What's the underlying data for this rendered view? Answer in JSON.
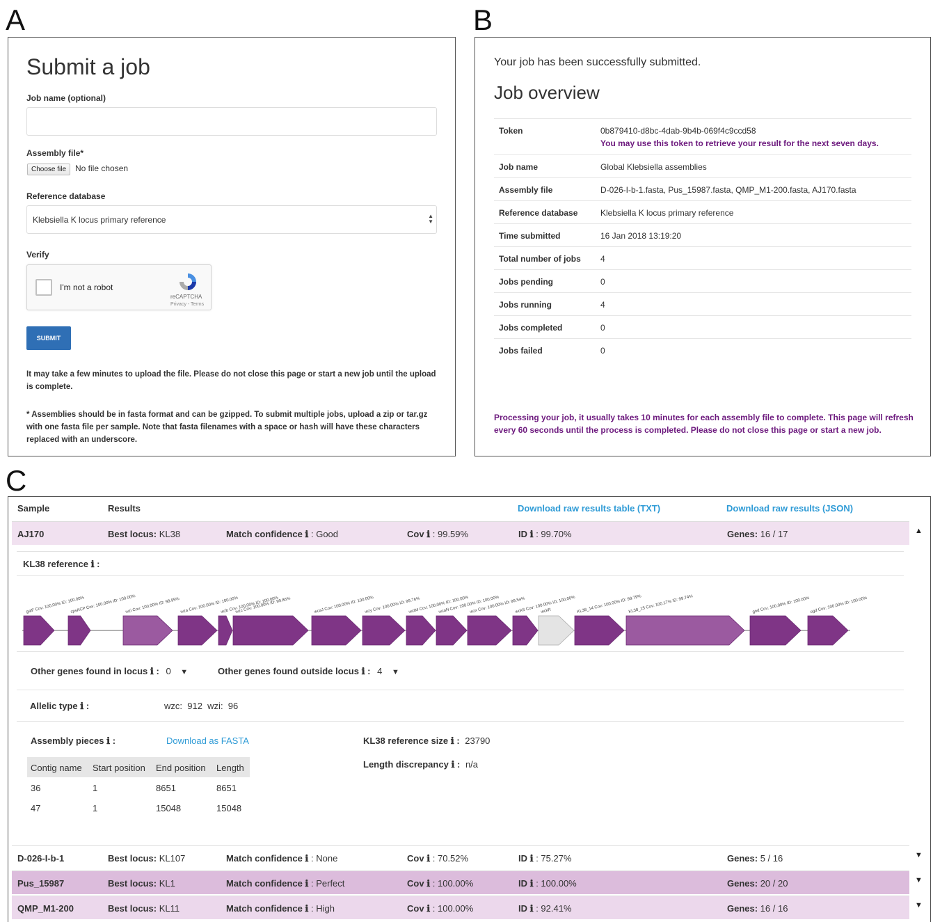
{
  "panels": {
    "a": "A",
    "b": "B",
    "c": "C"
  },
  "submit_form": {
    "title": "Submit a job",
    "job_name_label": "Job name (optional)",
    "job_name_value": "",
    "assembly_label": "Assembly file*",
    "choose_file": "Choose file",
    "no_file": "No file chosen",
    "ref_db_label": "Reference database",
    "ref_db_value": "Klebsiella K locus primary reference",
    "verify_label": "Verify",
    "captcha_text": "I'm not a robot",
    "captcha_brand": "reCAPTCHA",
    "captcha_links": "Privacy - Terms",
    "submit_label": "SUBMIT",
    "note1": "It may take a few minutes to upload the file. Please do not close this page or start a new job until the upload is complete.",
    "note2": "* Assemblies should be in fasta format and can be gzipped. To submit multiple jobs, upload a zip or tar.gz with one fasta file per sample. Note that fasta filenames with a space or hash will have these characters replaced with an underscore."
  },
  "job_overview": {
    "success": "Your job has been successfully submitted.",
    "title": "Job overview",
    "token_label": "Token",
    "token_value": "0b879410-d8bc-4dab-9b4b-069f4c9ccd58",
    "token_note": "You may use this token to retrieve your result for the next seven days.",
    "rows": [
      {
        "key": "Job name",
        "value": "Global Klebsiella assemblies"
      },
      {
        "key": "Assembly file",
        "value": "D-026-I-b-1.fasta, Pus_15987.fasta, QMP_M1-200.fasta, AJ170.fasta"
      },
      {
        "key": "Reference database",
        "value": "Klebsiella K locus primary reference"
      },
      {
        "key": "Time submitted",
        "value": "16 Jan 2018 13:19:20"
      },
      {
        "key": "Total number of jobs",
        "value": "4"
      },
      {
        "key": "Jobs pending",
        "value": "0"
      },
      {
        "key": "Jobs running",
        "value": "4"
      },
      {
        "key": "Jobs completed",
        "value": "0"
      },
      {
        "key": "Jobs failed",
        "value": "0"
      }
    ],
    "processing_note": "Processing your job, it usually takes 10 minutes for each assembly file to complete. This page will refresh every 60 seconds until the process is completed. Please do not close this page or start a new job."
  },
  "results": {
    "header": {
      "sample": "Sample",
      "results": "Results",
      "download_txt": "Download raw results table (TXT)",
      "download_json": "Download raw results (JSON)"
    },
    "labels": {
      "best_locus": "Best locus:",
      "match_conf": "Match confidence",
      "cov": "Cov",
      "id": "ID",
      "genes": "Genes:"
    },
    "expanded": {
      "sample": "AJ170",
      "locus": "KL38",
      "confidence": "Good",
      "cov": "99.59%",
      "id": "99.70%",
      "genes": "16 / 17",
      "reference_title": "KL38 reference",
      "other_in_label": "Other genes found in locus",
      "other_in_value": "0",
      "other_out_label": "Other genes found outside locus",
      "other_out_value": "4",
      "allelic_label": "Allelic type",
      "allelic_wzc_label": "wzc:",
      "allelic_wzc_value": "912",
      "allelic_wzi_label": "wzi:",
      "allelic_wzi_value": "96",
      "pieces_label": "Assembly pieces",
      "download_fasta": "Download as FASTA",
      "ref_size_label": "KL38 reference size",
      "ref_size_value": "23790",
      "length_disc_label": "Length discrepancy",
      "length_disc_value": "n/a",
      "table_headers": [
        "Contig name",
        "Start position",
        "End position",
        "Length"
      ],
      "table_rows": [
        [
          "36",
          "1",
          "8651",
          "8651"
        ],
        [
          "47",
          "1",
          "15048",
          "15048"
        ]
      ]
    },
    "genes": [
      {
        "label": "galF Cov: 100.00% ID: 100.00%",
        "color": "#7f3586"
      },
      {
        "label": "cpsACP Cov: 100.00% ID: 100.00%",
        "color": "#7f3586"
      },
      {
        "label": "wzi Cov: 100.00% ID: 98.95%",
        "color": "#9b5aa0"
      },
      {
        "label": "wza Cov: 100.00% ID: 100.00%",
        "color": "#7f3586"
      },
      {
        "label": "wzb Cov: 100.00% ID: 100.00%",
        "color": "#7f3586"
      },
      {
        "label": "wzc Cov: 100.00% ID: 99.86%",
        "color": "#7f3586"
      },
      {
        "label": "wcaJ Cov: 100.00% ID: 100.00%",
        "color": "#7f3586"
      },
      {
        "label": "wzy Cov: 100.00% ID: 99.76%",
        "color": "#7f3586"
      },
      {
        "label": "wctM Cov: 100.00% ID: 100.00%",
        "color": "#7f3586"
      },
      {
        "label": "wcaN Cov: 100.00% ID: 100.00%",
        "color": "#7f3586"
      },
      {
        "label": "wzx Cov: 100.00% ID: 99.54%",
        "color": "#7f3586"
      },
      {
        "label": "wckS Cov: 100.00% ID: 100.00%",
        "color": "#7f3586"
      },
      {
        "label": "wckR",
        "color": "#e4e4e4"
      },
      {
        "label": "KL38_14 Cov: 100.00% ID: 99.79%",
        "color": "#7f3586"
      },
      {
        "label": "KL38_15 Cov: 100.17% ID: 99.74%",
        "color": "#9b5aa0"
      },
      {
        "label": "gnd Cov: 100.00% ID: 100.00%",
        "color": "#7f3586"
      },
      {
        "label": "ugd Cov: 100.00% ID: 100.00%",
        "color": "#7f3586"
      }
    ],
    "collapsed": [
      {
        "sample": "D-026-I-b-1",
        "locus": "KL107",
        "confidence": "None",
        "cov": "70.52%",
        "id": "75.27%",
        "genes": "5 / 16",
        "bg": "#ffffff"
      },
      {
        "sample": "Pus_15987",
        "locus": "KL1",
        "confidence": "Perfect",
        "cov": "100.00%",
        "id": "100.00%",
        "genes": "20 / 20",
        "bg": "#dcbcdc"
      },
      {
        "sample": "QMP_M1-200",
        "locus": "KL11",
        "confidence": "High",
        "cov": "100.00%",
        "id": "92.41%",
        "genes": "16 / 16",
        "bg": "#ecd8ec"
      }
    ],
    "colors": {
      "expanded_bg": "#f1e1f0",
      "accent": "#6d1a7e",
      "link": "#2f9bd6"
    }
  }
}
